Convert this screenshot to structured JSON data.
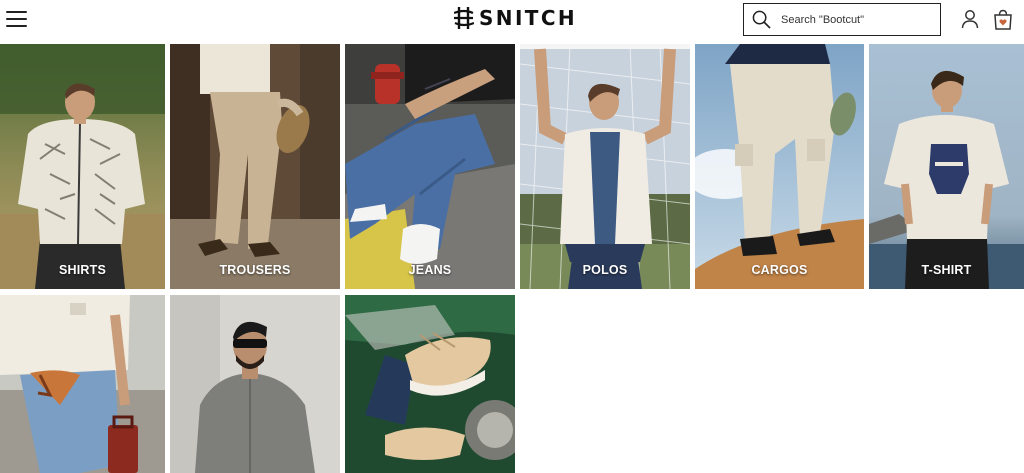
{
  "header": {
    "brand": "SNITCH",
    "search": {
      "placeholder": "Search \"Bootcut\""
    },
    "icons": {
      "menu": "hamburger-menu-icon",
      "search": "search-icon",
      "user": "user-icon",
      "bag": "shopping-bag-icon"
    },
    "brand_color": "#111111"
  },
  "categories": [
    {
      "label": "SHIRTS"
    },
    {
      "label": "TROUSERS"
    },
    {
      "label": "JEANS"
    },
    {
      "label": "POLOS"
    },
    {
      "label": "CARGOS"
    },
    {
      "label": "T-SHIRT"
    },
    {
      "label": ""
    },
    {
      "label": ""
    },
    {
      "label": ""
    }
  ]
}
